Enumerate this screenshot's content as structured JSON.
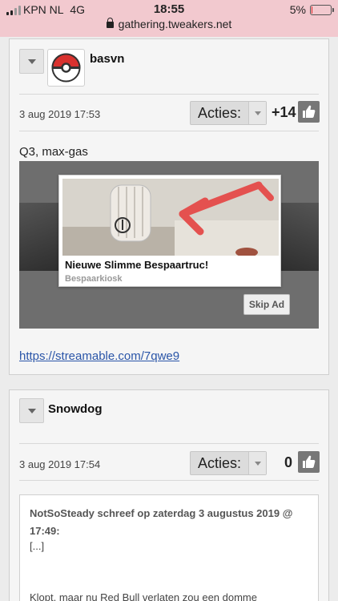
{
  "status_bar": {
    "carrier": "KPN NL",
    "network": "4G",
    "time": "18:55",
    "battery_percent": "5%",
    "battery_level": 0.05,
    "url": "gathering.tweakers.net"
  },
  "posts": [
    {
      "author": "basvn",
      "avatar_icon": "pokeball-icon",
      "date": "3 aug 2019 17:53",
      "actions_label": "Acties:",
      "score": "+14",
      "text": "Q3, max-gas",
      "link": "https://streamable.com/7qwe9",
      "ad": {
        "title": "Nieuwe Slimme Bespaartruc!",
        "source": "Bespaarkiosk",
        "skip_label": "Skip Ad"
      }
    },
    {
      "author": "Snowdog",
      "date": "3 aug 2019 17:54",
      "actions_label": "Acties:",
      "score": "0",
      "quote": {
        "header": "NotSoSteady schreef op zaterdag 3 augustus 2019 @ 17:49:",
        "ellipsis": "[...]",
        "body": "Klopt, maar nu Red Bull verlaten zou een domme"
      }
    }
  ],
  "colors": {
    "status_bg": "#f2c9cf",
    "link": "#2a55a8",
    "battery_low": "#e22222"
  }
}
